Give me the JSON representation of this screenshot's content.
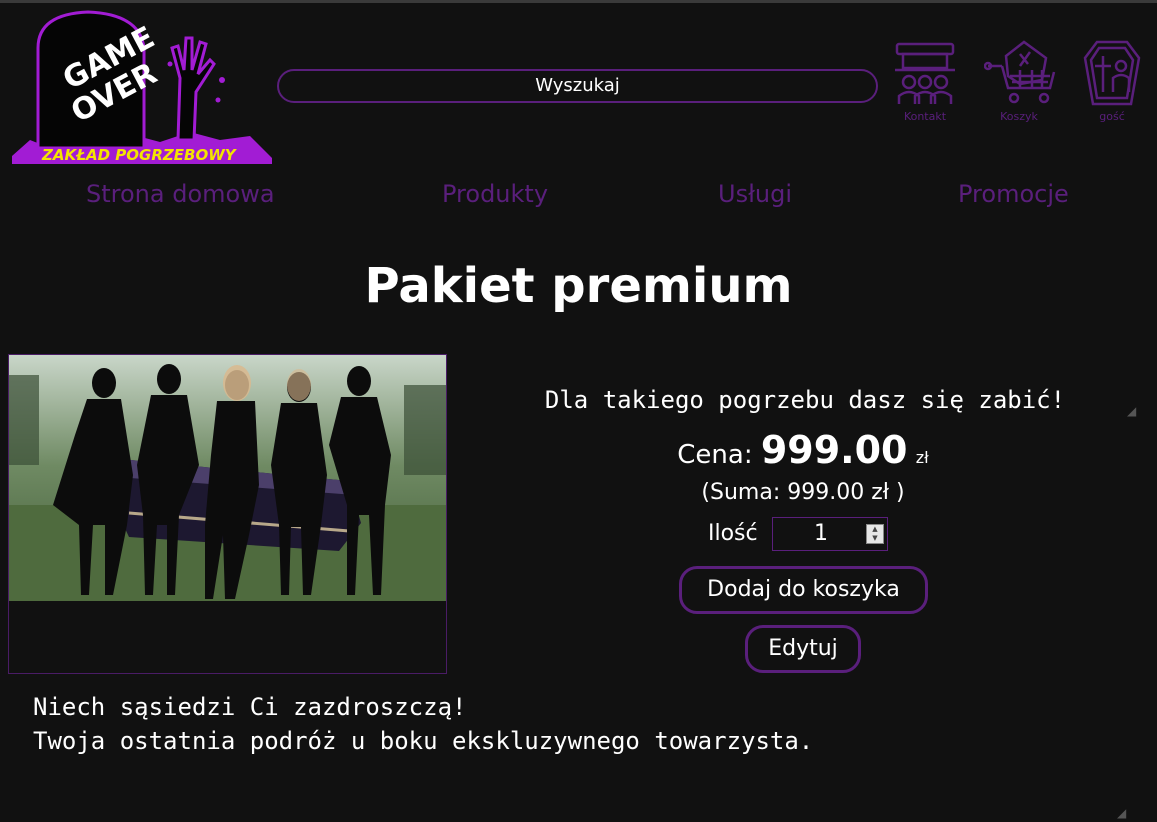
{
  "logo": {
    "line1": "GAME",
    "line2": "OVER",
    "tagline": "ZAKŁAD POGRZEBOWY"
  },
  "search": {
    "placeholder": "Wyszukaj"
  },
  "header_icons": [
    {
      "label": "Kontakt",
      "icon": "mourners-icon"
    },
    {
      "label": "Koszyk",
      "icon": "coffin-cart-icon"
    },
    {
      "label": "gość",
      "icon": "coffin-user-icon"
    }
  ],
  "nav": [
    "Strona domowa",
    "Produkty",
    "Usługi",
    "Promocje"
  ],
  "product": {
    "title": "Pakiet premium",
    "tagline": "Dla takiego pogrzebu dasz się zabić!",
    "price_label": "Cena:",
    "price": "999.00",
    "currency": "zł",
    "sum_text": "(Suma: 999.00 zł )",
    "quantity_label": "Ilość",
    "quantity": "1",
    "add_button": "Dodaj do koszyka",
    "edit_button": "Edytuj",
    "description": [
      "Niech sąsiedzi Ci zazdroszczą!",
      "Twoja ostatnia podróż u boku ekskluzywnego towarzysta."
    ]
  },
  "colors": {
    "background": "#111111",
    "accent": "#5a1f7c",
    "logo_purple": "#a21cd4",
    "tagline_yellow": "#f4e400"
  }
}
